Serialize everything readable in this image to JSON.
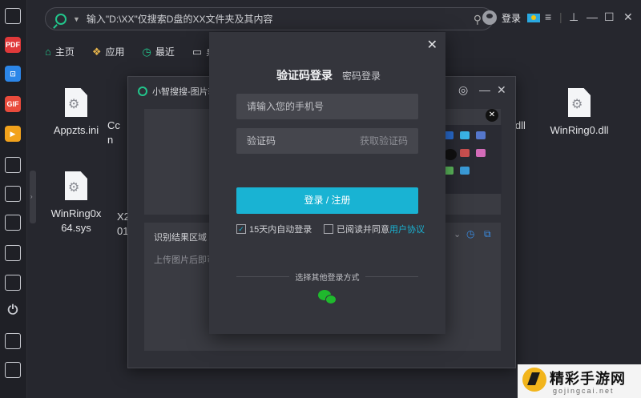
{
  "search": {
    "placeholder": "输入\"D:\\XX\"仅搜索D盘的XX文件夹及其内容"
  },
  "user": {
    "login_label": "登录"
  },
  "nav": [
    {
      "icon": "home-icon",
      "label": "主页"
    },
    {
      "icon": "apps-icon",
      "label": "应用"
    },
    {
      "icon": "clock-icon",
      "label": "最近"
    },
    {
      "icon": "monitor-icon",
      "label": "桌"
    }
  ],
  "files": [
    {
      "name": "Appzts.ini"
    },
    {
      "name": "Cc"
    },
    {
      "name": "n"
    },
    {
      "name": "L.dll"
    },
    {
      "name": "WinRing0.dll"
    },
    {
      "name": "WinRing0x64.sys"
    },
    {
      "name": "X2"
    },
    {
      "name": "01"
    }
  ],
  "bg_window": {
    "title": "小智搜搜-图片转",
    "result_header": "识别结果区域",
    "result_placeholder": "上传图片后即可"
  },
  "login": {
    "tab_sms": "验证码登录",
    "tab_password": "密码登录",
    "phone_placeholder": "请输入您的手机号",
    "code_placeholder": "验证码",
    "get_code": "获取验证码",
    "submit": "登录 / 注册",
    "auto_login": "15天内自动登录",
    "agree_prefix": "已阅读并同意",
    "agree_link": "用户协议",
    "other_methods": "选择其他登录方式"
  },
  "watermark": {
    "title": "精彩手游网",
    "url": "gojingcai.net"
  },
  "colors": {
    "accent": "#19b3d3",
    "search_green": "#22c58b",
    "wechat": "#1fb92d"
  }
}
